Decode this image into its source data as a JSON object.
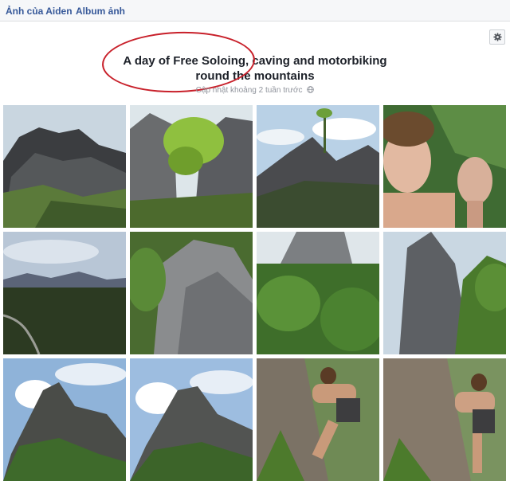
{
  "nav": {
    "tab_photos_of": "Ảnh của Aiden",
    "tab_albums": "Album ảnh"
  },
  "album": {
    "title_line1": "A day of Free Soloing, caving and motorbiking",
    "title_line2": "round the mountains",
    "updated": "Cập nhật khoảng 2 tuần trước",
    "privacy_icon": "globe-icon"
  },
  "settings_icon": "gear-icon",
  "annotation_color": "#c8202a",
  "photos": [
    {
      "name": "photo-rocky-peak"
    },
    {
      "name": "photo-cliff-tree"
    },
    {
      "name": "photo-summit-palm"
    },
    {
      "name": "photo-selfie-man"
    },
    {
      "name": "photo-valley-road"
    },
    {
      "name": "photo-rock-face"
    },
    {
      "name": "photo-green-cliff"
    },
    {
      "name": "photo-limestone-wall"
    },
    {
      "name": "photo-hill-clouds-1"
    },
    {
      "name": "photo-hill-clouds-2"
    },
    {
      "name": "photo-climber-1"
    },
    {
      "name": "photo-climber-2"
    }
  ]
}
